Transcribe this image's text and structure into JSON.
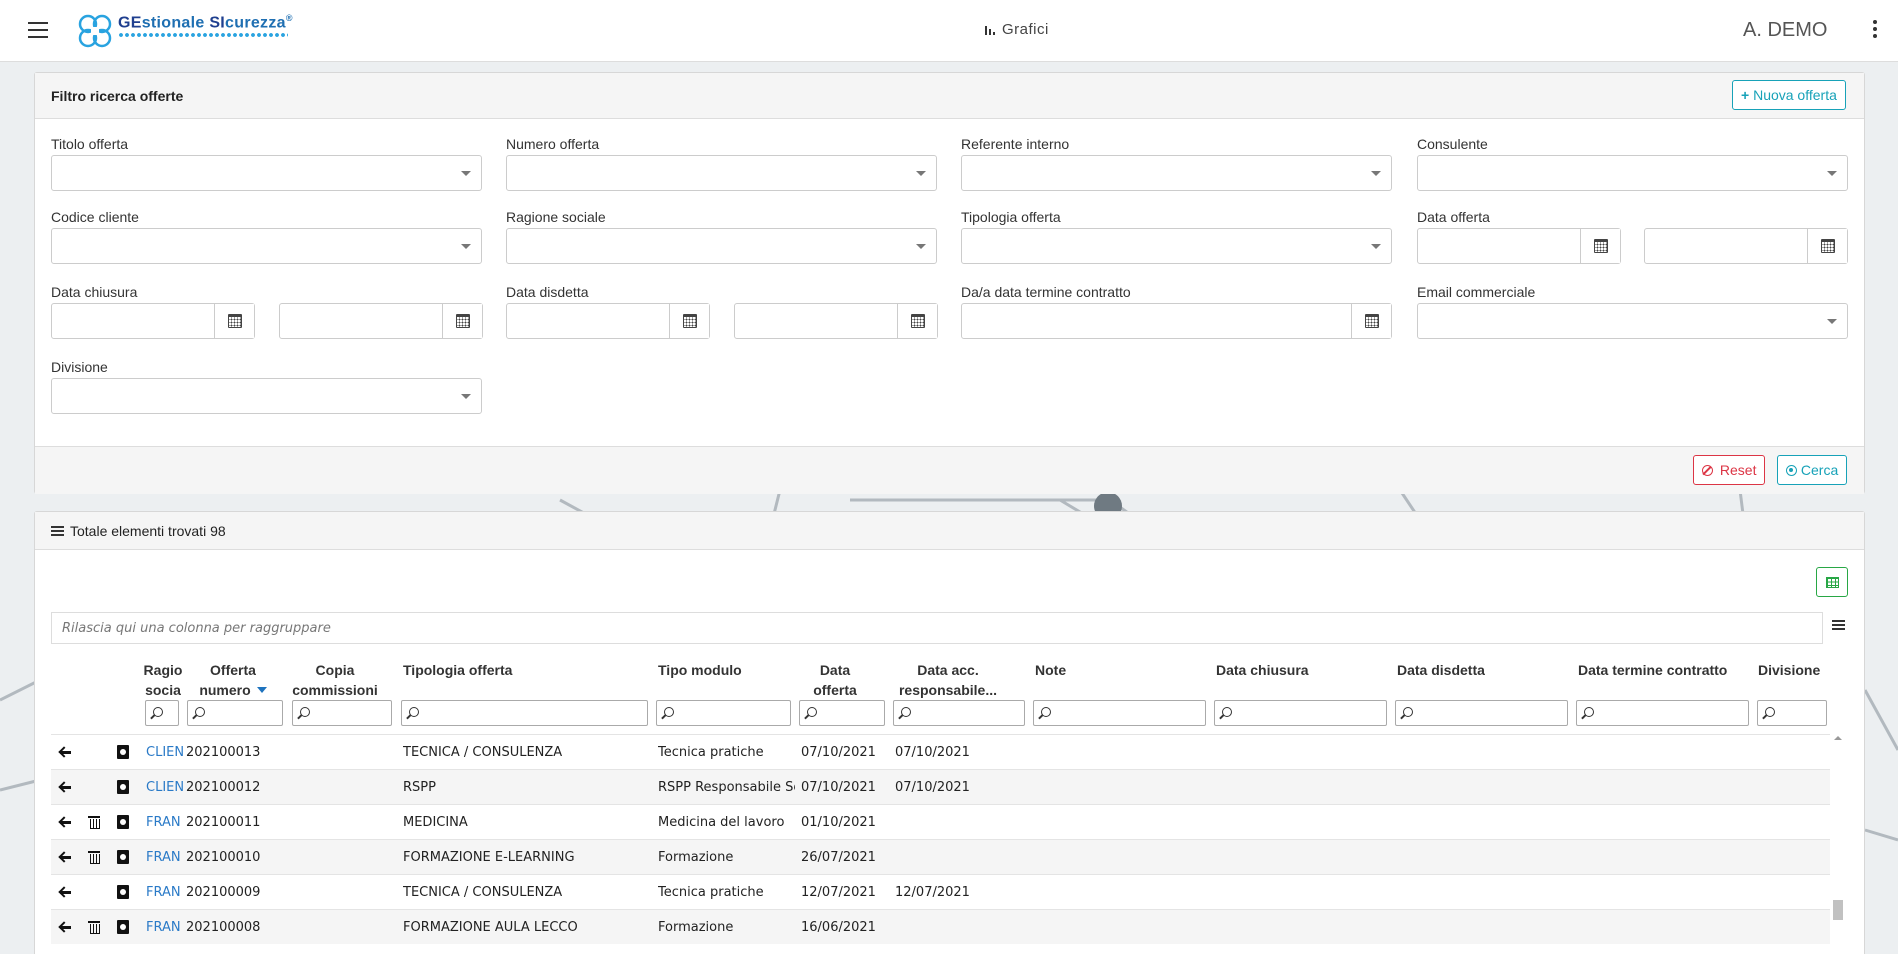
{
  "topbar": {
    "logo_text_a": "GE",
    "logo_text_b": "stionale ",
    "logo_text_c": "SI",
    "logo_text_d": "curezza",
    "logo_reg": "®",
    "grafici_label": "Grafici",
    "user_name": "A. DEMO"
  },
  "filter": {
    "title": "Filtro ricerca offerte",
    "new_offer_label": "Nuova offerta",
    "fields": {
      "titolo_offerta": "Titolo offerta",
      "numero_offerta": "Numero offerta",
      "referente_interno": "Referente interno",
      "consulente": "Consulente",
      "codice_cliente": "Codice cliente",
      "ragione_sociale": "Ragione sociale",
      "tipologia_offerta": "Tipologia offerta",
      "data_offerta": "Data offerta",
      "data_chiusura": "Data chiusura",
      "data_disdetta": "Data disdetta",
      "data_termine": "Da/a data termine contratto",
      "email_commerciale": "Email commerciale",
      "divisione": "Divisione"
    },
    "reset_label": "Reset",
    "search_label": "Cerca"
  },
  "results": {
    "title": "Totale elementi trovati 98",
    "group_placeholder": "Rilascia qui una colonna per raggruppare",
    "columns": {
      "ragione_1": "Ragio",
      "ragione_2": "socia",
      "offerta_1": "Offerta",
      "offerta_2": "numero",
      "copia_1": "Copia",
      "copia_2": "commissioni",
      "tipologia": "Tipologia offerta",
      "tipo_modulo": "Tipo modulo",
      "data_offerta_1": "Data",
      "data_offerta_2": "offerta",
      "data_acc_1": "Data acc.",
      "data_acc_2": "responsabile...",
      "note": "Note",
      "data_chiusura": "Data chiusura",
      "data_disdetta": "Data disdetta",
      "data_termine": "Data termine contratto",
      "divisione": "Divisione"
    },
    "rows": [
      {
        "ragione": "CLIEN",
        "numero": "202100013",
        "tipologia": "TECNICA / CONSULENZA",
        "modulo": "Tecnica pratiche",
        "data_offerta": "07/10/2021",
        "data_acc": "07/10/2021",
        "trash": false
      },
      {
        "ragione": "CLIEN",
        "numero": "202100012",
        "tipologia": "RSPP",
        "modulo": "RSPP Responsabile Ser",
        "data_offerta": "07/10/2021",
        "data_acc": "07/10/2021",
        "trash": false
      },
      {
        "ragione": "FRAN",
        "numero": "202100011",
        "tipologia": "MEDICINA",
        "modulo": "Medicina del lavoro",
        "data_offerta": "01/10/2021",
        "data_acc": "",
        "trash": true
      },
      {
        "ragione": "FRAN",
        "numero": "202100010",
        "tipologia": "FORMAZIONE E-LEARNING",
        "modulo": "Formazione",
        "data_offerta": "26/07/2021",
        "data_acc": "",
        "trash": true
      },
      {
        "ragione": "FRAN",
        "numero": "202100009",
        "tipologia": "TECNICA / CONSULENZA",
        "modulo": "Tecnica pratiche",
        "data_offerta": "12/07/2021",
        "data_acc": "12/07/2021",
        "trash": false
      },
      {
        "ragione": "FRAN",
        "numero": "202100008",
        "tipologia": "FORMAZIONE AULA LECCO",
        "modulo": "Formazione",
        "data_offerta": "16/06/2021",
        "data_acc": "",
        "trash": true
      }
    ]
  },
  "colors": {
    "accent_info": "#17a2b8",
    "danger": "#dc3545",
    "success": "#28a745",
    "link": "#2a7ac7"
  }
}
